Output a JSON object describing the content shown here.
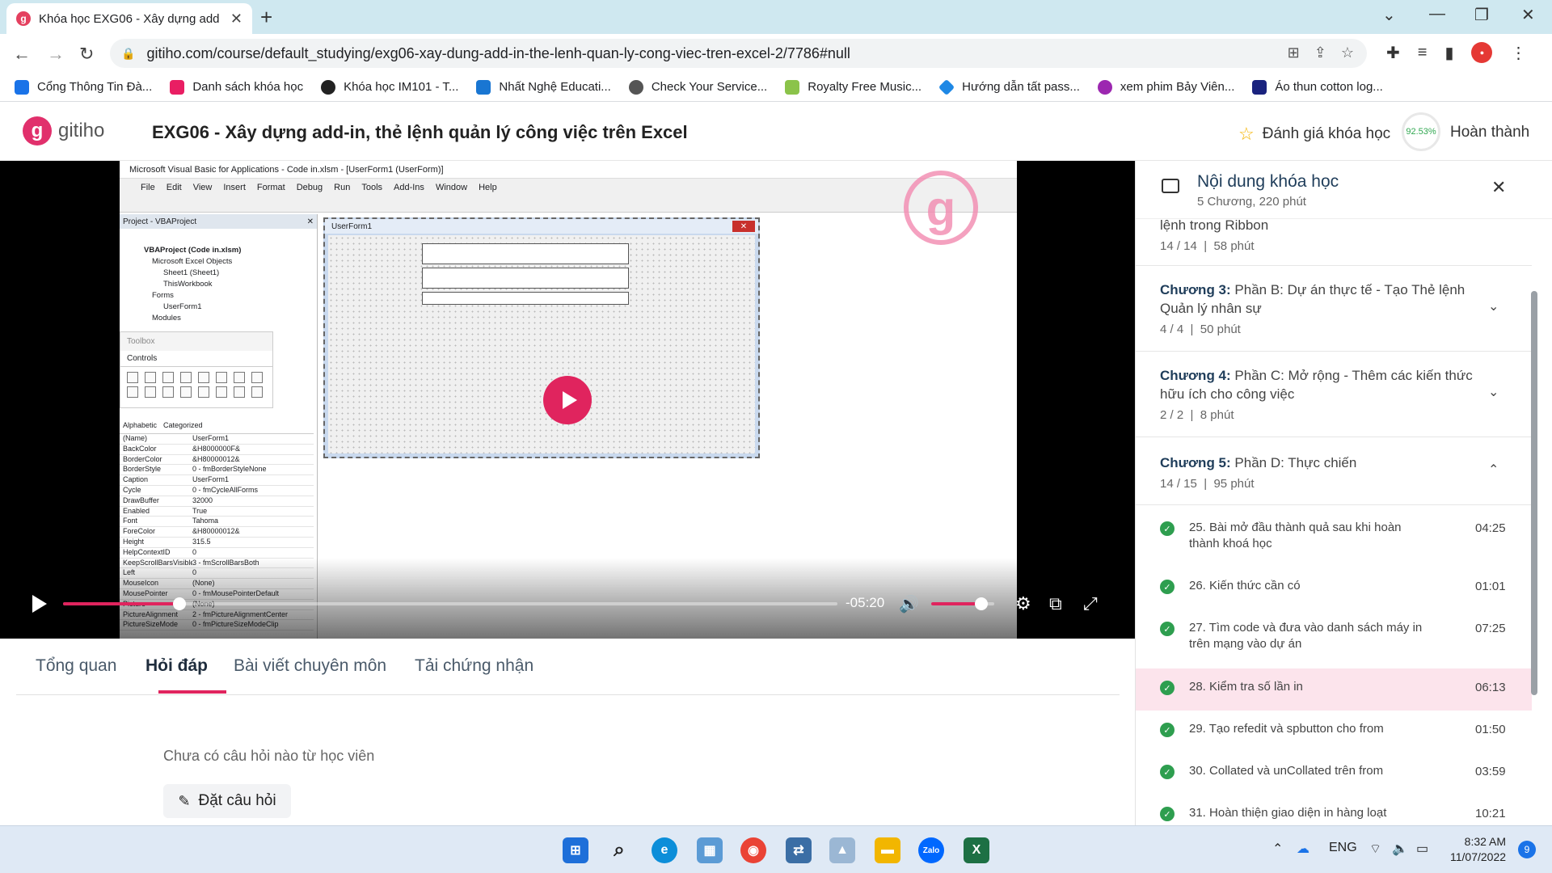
{
  "browser": {
    "tab_title": "Khóa học EXG06 - Xây dựng add",
    "url": "gitiho.com/course/default_studying/exg06-xay-dung-add-in-the-lenh-quan-ly-cong-viec-tren-excel-2/7786#null",
    "bookmarks": [
      {
        "label": "Cổng Thông Tin Đà...",
        "icon": "sgu-icon",
        "color": "#1a73e8"
      },
      {
        "label": "Danh sách khóa học",
        "icon": "link-icon",
        "color": "#e91e63"
      },
      {
        "label": "Khóa học IM101 - T...",
        "icon": "dark-circle-icon",
        "color": "#222222"
      },
      {
        "label": "Nhất Nghệ Educati...",
        "icon": "nhat-nghe-icon",
        "color": "#1976d2"
      },
      {
        "label": "Check Your Service...",
        "icon": "apple-icon",
        "color": "#555555"
      },
      {
        "label": "Royalty Free Music...",
        "icon": "b-icon",
        "color": "#8bc34a"
      },
      {
        "label": "Hướng dẫn tất pass...",
        "icon": "diamond-icon",
        "color": "#1e88e5"
      },
      {
        "label": "xem phim Bảy Viên...",
        "icon": "character-icon",
        "color": "#9c27b0"
      },
      {
        "label": "Áo thun cotton log...",
        "icon": "p-icon",
        "color": "#1a237e"
      }
    ]
  },
  "header": {
    "logo_text": "gitiho",
    "course_title": "EXG06 - Xây dựng add-in, thẻ lệnh quản lý công việc trên Excel",
    "rate_label": "Đánh giá khóa học",
    "progress": "92.53%",
    "complete_label": "Hoàn thành"
  },
  "video": {
    "vba_title": "Microsoft Visual Basic for Applications - Code in.xlsm - [UserForm1 (UserForm)]",
    "vba_menu": [
      "File",
      "Edit",
      "View",
      "Insert",
      "Format",
      "Debug",
      "Run",
      "Tools",
      "Add-Ins",
      "Window",
      "Help"
    ],
    "project_header": "Project - VBAProject",
    "tree": [
      "VBAProject (Code in.xlsm)",
      "Microsoft Excel Objects",
      "Sheet1 (Sheet1)",
      "ThisWorkbook",
      "Forms",
      "UserForm1",
      "Modules"
    ],
    "toolbox_title": "Toolbox",
    "toolbox_tab": "Controls",
    "prop_tabs": [
      "Alphabetic",
      "Categorized"
    ],
    "properties": [
      [
        "(Name)",
        "UserForm1"
      ],
      [
        "BackColor",
        "&H8000000F&"
      ],
      [
        "BorderColor",
        "&H80000012&"
      ],
      [
        "BorderStyle",
        "0 - fmBorderStyleNone"
      ],
      [
        "Caption",
        "UserForm1"
      ],
      [
        "Cycle",
        "0 - fmCycleAllForms"
      ],
      [
        "DrawBuffer",
        "32000"
      ],
      [
        "Enabled",
        "True"
      ],
      [
        "Font",
        "Tahoma"
      ],
      [
        "ForeColor",
        "&H80000012&"
      ],
      [
        "Height",
        "315.5"
      ],
      [
        "HelpContextID",
        "0"
      ],
      [
        "KeepScrollBarsVisible",
        "3 - fmScrollBarsBoth"
      ],
      [
        "Left",
        "0"
      ],
      [
        "MouseIcon",
        "(None)"
      ],
      [
        "MousePointer",
        "0 - fmMousePointerDefault"
      ],
      [
        "Picture",
        "(None)"
      ],
      [
        "PictureAlignment",
        "2 - fmPictureAlignmentCenter"
      ],
      [
        "PictureSizeMode",
        "0 - fmPictureSizeModeClip"
      ]
    ],
    "userform_caption": "UserForm1",
    "time_remaining": "-05:20",
    "seek_progress": 0.15,
    "volume": 0.8
  },
  "tabs": {
    "items": [
      "Tổng quan",
      "Hỏi đáp",
      "Bài viết chuyên môn",
      "Tải chứng nhận"
    ],
    "active": "Hỏi đáp"
  },
  "qa": {
    "empty_text": "Chưa có câu hỏi nào từ học viên",
    "ask_button": "Đặt câu hỏi"
  },
  "sidebar": {
    "title": "Nội dung khóa học",
    "subtitle": "5 Chương, 220 phút",
    "partial_chapter": {
      "title": "lệnh trong Ribbon",
      "meta_count": "14 / 14",
      "meta_time": "58 phút"
    },
    "chapters": [
      {
        "num": "Chương 3:",
        "title": "Phần B: Dự án thực tế - Tạo Thẻ lệnh Quản lý nhân sự",
        "count": "4 / 4",
        "time": "50 phút"
      },
      {
        "num": "Chương 4:",
        "title": "Phần C: Mở rộng - Thêm các kiến thức hữu ích cho công việc",
        "count": "2 / 2",
        "time": "8 phút"
      },
      {
        "num": "Chương 5:",
        "title": "Phần D: Thực chiến",
        "count": "14 / 15",
        "time": "95 phút"
      }
    ],
    "lessons": [
      {
        "title": "25. Bài mở đầu thành quả sau khi hoàn thành khoá học",
        "duration": "04:25"
      },
      {
        "title": "26. Kiến thức cần có",
        "duration": "01:01"
      },
      {
        "title": "27. Tìm code và đưa vào danh sách máy in trên mạng vào dự án",
        "duration": "07:25"
      },
      {
        "title": "28. Kiểm tra số lần in",
        "duration": "06:13"
      },
      {
        "title": "29. Tạo refedit và spbutton cho from",
        "duration": "01:50"
      },
      {
        "title": "30. Collated và unCollated trên from",
        "duration": "03:59"
      },
      {
        "title": "31. Hoàn thiện giao diện in hàng loạt",
        "duration": "10:21"
      }
    ],
    "meta_separator": "|"
  },
  "taskbar": {
    "language": "ENG",
    "time": "8:32 AM",
    "date": "11/07/2022",
    "notifications": "9"
  }
}
